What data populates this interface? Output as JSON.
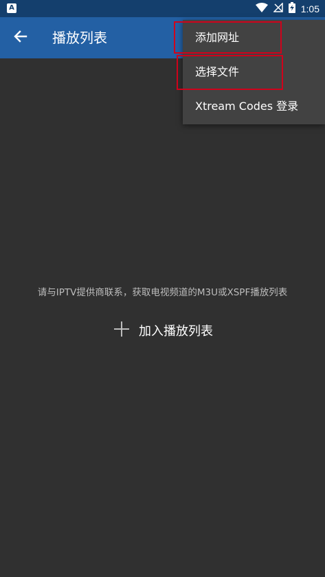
{
  "status_bar": {
    "left_icon_letter": "A",
    "time": "1:05",
    "icons": [
      "wifi-icon",
      "no-signal-icon",
      "battery-charging-icon"
    ]
  },
  "app_bar": {
    "back_icon": "arrow-left-icon",
    "title": "播放列表"
  },
  "menu": {
    "items": [
      {
        "label": "添加网址"
      },
      {
        "label": "选择文件"
      },
      {
        "label": "Xtream Codes 登录"
      }
    ],
    "highlight_color": "#d0021b"
  },
  "empty_state": {
    "message": "请与IPTV提供商联系，获取电视频道的M3U或XSPF播放列表",
    "add_button_label": "加入播放列表",
    "add_icon": "plus-icon"
  },
  "colors": {
    "status_bar": "#143f6d",
    "app_bar": "#2360a4",
    "background": "#303030",
    "menu_background": "#424242"
  }
}
